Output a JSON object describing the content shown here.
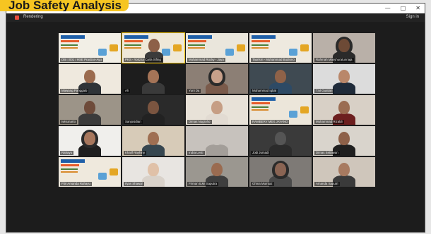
{
  "overlay": {
    "banner_text": "Job Safety Analysis"
  },
  "window": {
    "app_title": "Rendering",
    "sign_in": "Sign in",
    "controls": [
      "—",
      "□",
      "✕"
    ]
  },
  "colors": {
    "banner": "#f6c521",
    "active_speaker": "#f2c200",
    "tile_bg": "#2b2b2b"
  },
  "participants": [
    {
      "name": "DBI | 001 / HSE Practice-Ayu",
      "type": "poster",
      "bg": "#f2efe6"
    },
    {
      "name": "PKS - Yorizza Carla Sifing",
      "type": "poster-person",
      "bg": "#efe8d8",
      "highlight": true
    },
    {
      "name": "Muhammad Rocky - Jaya",
      "type": "poster",
      "bg": "#eae6dc"
    },
    {
      "name": "Taurism - Muhammad Budiono",
      "type": "poster",
      "bg": "#eee9df"
    },
    {
      "name": "Rahmah Masyhuratunnaja",
      "type": "person",
      "bg": "#b9b0a8",
      "face": "#6d4a36",
      "body": "#2a2a2a",
      "hijab": true
    },
    {
      "name": "Mawang Panggalo",
      "type": "person",
      "bg": "#efe9de",
      "face": "#9b6b4e",
      "body": "#2f3438"
    },
    {
      "name": "Ali",
      "type": "person",
      "bg": "#1d1d1d",
      "face": "#a57457",
      "body": "#3a3a3a"
    },
    {
      "name": "Yuni Da",
      "type": "person",
      "bg": "#8c7f75",
      "face": "#c8a08a",
      "body": "#7a5a4a",
      "hijab": true
    },
    {
      "name": "Muhammad Iqbal",
      "type": "person",
      "bg": "#3f4a52",
      "face": "#8f6248",
      "body": "#2d4a65"
    },
    {
      "name": "T.M Gustian",
      "type": "person",
      "bg": "#dcdcdc",
      "face": "#b9876a",
      "body": "#1f2b3a"
    },
    {
      "name": "Iwisunarto",
      "type": "person",
      "bg": "#9c9488",
      "face": "#6e4b3a",
      "body": "#3b3b3b"
    },
    {
      "name": "Sanjosidian",
      "type": "person",
      "bg": "#2a2a2a",
      "face": "#7b5540",
      "body": "#222"
    },
    {
      "name": "Dimas Nugroho",
      "type": "person",
      "bg": "#e8e2d8",
      "face": "#c69e84",
      "body": "#e2dbd2"
    },
    {
      "name": "RAMBERY MEX JAYANO",
      "type": "poster",
      "bg": "#ece6da"
    },
    {
      "name": "Muhammad Rizaldi",
      "type": "person",
      "bg": "#d8d0c6",
      "face": "#9a6c52",
      "body": "#6d1f1f"
    },
    {
      "name": "Rahayu",
      "type": "person",
      "bg": "#f0efec",
      "face": "#a7775d",
      "body": "#1f1f1f",
      "hijab": true
    },
    {
      "name": "Khalif Rayhiny",
      "type": "person",
      "bg": "#d7cbb8",
      "face": "#9f6f52",
      "body": "#36464f"
    },
    {
      "name": "Indra Lesti",
      "type": "person",
      "bg": "#c7c2bd",
      "face": "#c7c2bd",
      "body": "#a39e99"
    },
    {
      "name": "Jodi Jumadi",
      "type": "person",
      "bg": "#3a3a3a",
      "face": "#555",
      "body": "#2b2b2b"
    },
    {
      "name": "Dimas Setiawan",
      "type": "person",
      "bg": "#d9d4cc",
      "face": "#8e6149",
      "body": "#1f1f1f"
    },
    {
      "name": "Fitri Amanda Rahayu",
      "type": "poster",
      "bg": "#efe9dd"
    },
    {
      "name": "Ilyas Shawal",
      "type": "person",
      "bg": "#e8e5e1",
      "face": "#e0c1a8",
      "body": "#d9d2ca"
    },
    {
      "name": "Firman ILMI Saputra",
      "type": "person",
      "bg": "#9b9790",
      "face": "#9a6b50",
      "body": "#3e3e3e"
    },
    {
      "name": "Ghina Mumtaz",
      "type": "person",
      "bg": "#7e7a76",
      "face": "#8a6453",
      "body": "#4a4a4a",
      "hijab": true
    },
    {
      "name": "Amanda Saputri",
      "type": "person",
      "bg": "#cfc6bb",
      "face": "#a77a60",
      "body": "#3a3a3a"
    }
  ]
}
